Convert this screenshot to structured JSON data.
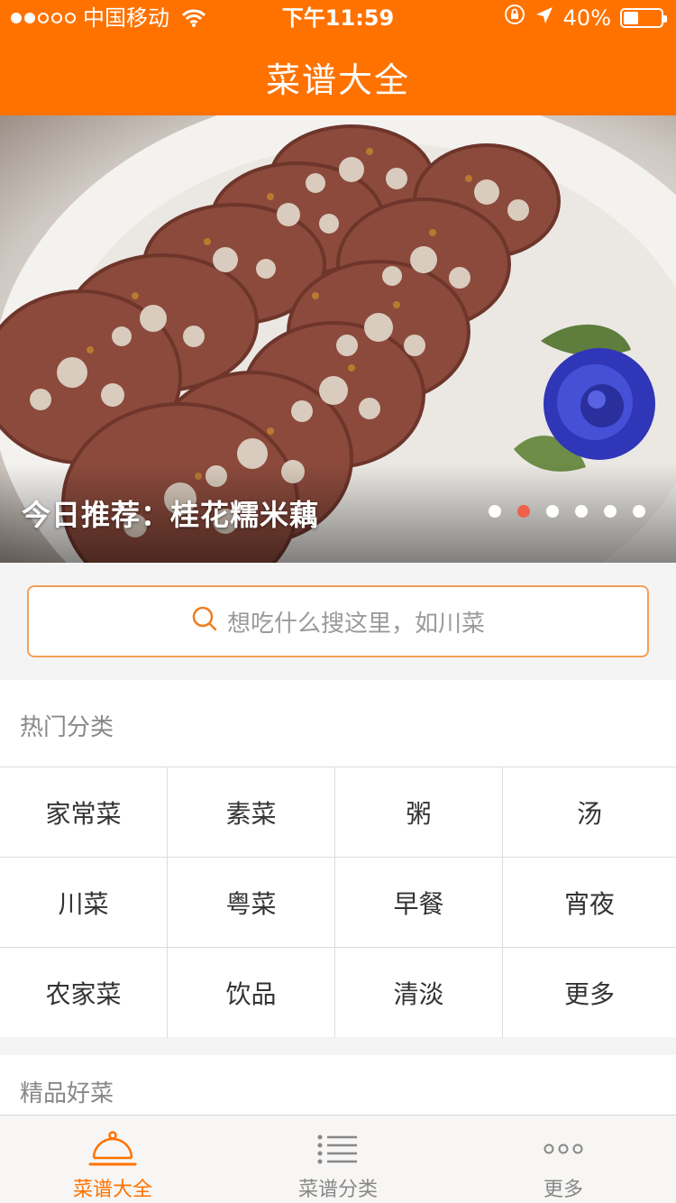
{
  "status_bar": {
    "carrier": "中国移动",
    "time": "下午11:59",
    "battery": "40%",
    "battery_level": 0.4
  },
  "header": {
    "title": "菜谱大全"
  },
  "banner": {
    "caption": "今日推荐：桂花糯米藕",
    "page_count": 6,
    "active_page": 1
  },
  "search": {
    "placeholder": "想吃什么搜这里，如川菜"
  },
  "hot_categories": {
    "title": "热门分类",
    "items": [
      "家常菜",
      "素菜",
      "粥",
      "汤",
      "川菜",
      "粤菜",
      "早餐",
      "宵夜",
      "农家菜",
      "饮品",
      "清淡",
      "更多"
    ]
  },
  "featured": {
    "title": "精品好菜"
  },
  "tabbar": {
    "tabs": [
      {
        "label": "菜谱大全",
        "icon": "cloche-icon",
        "active": true
      },
      {
        "label": "菜谱分类",
        "icon": "list-icon",
        "active": false
      },
      {
        "label": "更多",
        "icon": "more-dots-icon",
        "active": false
      }
    ]
  },
  "colors": {
    "brand": "#ff7200",
    "pager_active": "#f0604a",
    "search_border": "#f2a057"
  }
}
